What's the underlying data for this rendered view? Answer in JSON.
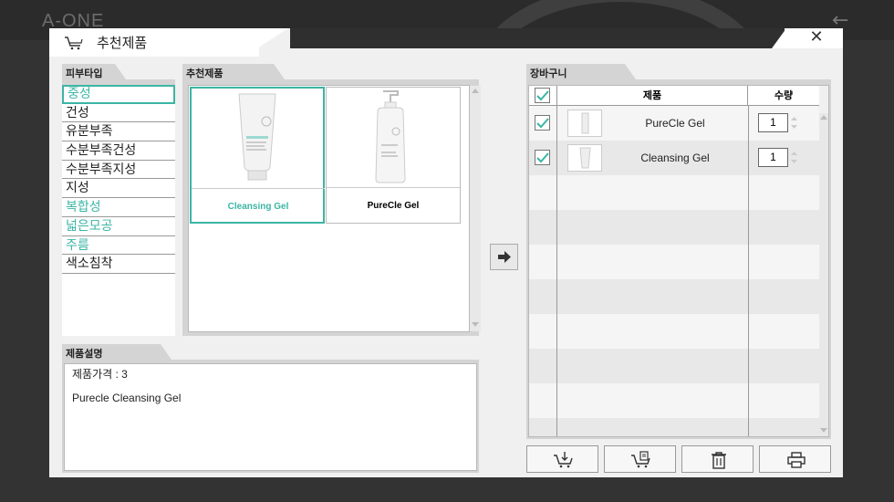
{
  "background": {
    "app_title": "A-ONE"
  },
  "dialog": {
    "title": "추천제품",
    "close_label": "✕"
  },
  "skin_panel": {
    "tab_label": "피부타입",
    "items": [
      {
        "label": "중성",
        "highlight": true,
        "selected": true
      },
      {
        "label": "건성",
        "highlight": false,
        "selected": false
      },
      {
        "label": "유분부족",
        "highlight": false,
        "selected": false
      },
      {
        "label": "수분부족건성",
        "highlight": false,
        "selected": false
      },
      {
        "label": "수분부족지성",
        "highlight": false,
        "selected": false
      },
      {
        "label": "지성",
        "highlight": false,
        "selected": false
      },
      {
        "label": "복합성",
        "highlight": true,
        "selected": false
      },
      {
        "label": "넓은모공",
        "highlight": true,
        "selected": false
      },
      {
        "label": "주름",
        "highlight": true,
        "selected": false
      },
      {
        "label": "색소침착",
        "highlight": false,
        "selected": false
      }
    ]
  },
  "products_panel": {
    "tab_label": "추천제품",
    "items": [
      {
        "name": "Cleansing Gel",
        "selected": true,
        "image": "tube-icon"
      },
      {
        "name": "PureCle Gel",
        "selected": false,
        "image": "pump-bottle-icon"
      }
    ]
  },
  "description_panel": {
    "tab_label": "제품설명",
    "price_line": "제품가격 : 3",
    "description": "Purecle Cleansing Gel"
  },
  "cart_panel": {
    "tab_label": "장바구니",
    "columns": [
      "제품",
      "수량"
    ],
    "header_checked": true,
    "rows": [
      {
        "name": "PureCle Gel",
        "qty": "1",
        "checked": true
      },
      {
        "name": "Cleansing Gel",
        "qty": "1",
        "checked": true
      }
    ]
  },
  "actions": {
    "move_icon": "arrow-right-icon",
    "buttons": [
      "cart-download-icon",
      "cart-document-icon",
      "trash-icon",
      "printer-icon"
    ]
  },
  "colors": {
    "accent": "#3bb5a4",
    "panel": "#d4d4d4",
    "dialog_bg": "#f0f0f0"
  }
}
